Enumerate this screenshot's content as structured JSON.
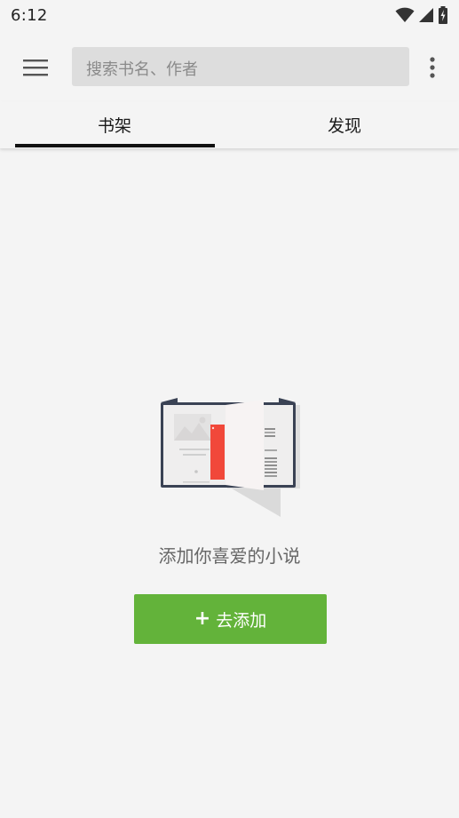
{
  "status_bar": {
    "time": "6:12",
    "icons": [
      "wifi-icon",
      "signal-icon",
      "battery-charging-icon"
    ]
  },
  "toolbar": {
    "menu_icon": "hamburger-menu-icon",
    "search_placeholder": "搜索书名、作者",
    "more_icon": "more-vertical-icon"
  },
  "tabs": [
    {
      "label": "书架",
      "selected": true
    },
    {
      "label": "发现",
      "selected": false
    }
  ],
  "empty_state": {
    "illustration": "open-book-icon",
    "message": "添加你喜爱的小说",
    "button_label": "去添加",
    "button_icon": "plus-icon"
  },
  "colors": {
    "background": "#f4f4f4",
    "search_bg": "#dddddd",
    "accent_green": "#63b33a",
    "tab_indicator": "#111111",
    "bookmark_red": "#f1483a"
  }
}
